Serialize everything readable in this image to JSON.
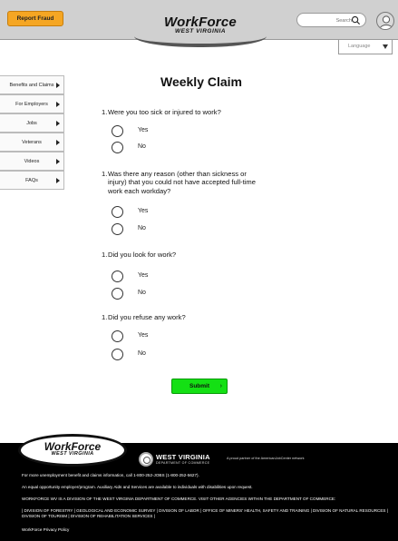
{
  "header": {
    "report_fraud_label": "Report Fraud",
    "logo_main": "WorkForce",
    "logo_sub": "WEST VIRGINIA",
    "search_placeholder": "Search",
    "language_label": "Language"
  },
  "sidebar": {
    "items": [
      {
        "label": "Benefits and Claims"
      },
      {
        "label": "For Employers"
      },
      {
        "label": "Jobs"
      },
      {
        "label": "Veterans"
      },
      {
        "label": "Videos"
      },
      {
        "label": "FAQs"
      }
    ]
  },
  "form": {
    "title": "Weekly Claim",
    "questions": [
      {
        "number": "1.",
        "text": "Were you too sick or injured to work?",
        "options": [
          "Yes",
          "No"
        ]
      },
      {
        "number": "1.",
        "text": "Was there any reason (other than sickness or injury) that you could not have accepted full-time work each workday?",
        "options": [
          "Yes",
          "No"
        ]
      },
      {
        "number": "1.",
        "text": "Did you look for work?",
        "options": [
          "Yes",
          "No"
        ]
      },
      {
        "number": "1.",
        "text": "Did you refuse any work?",
        "options": [
          "Yes",
          "No"
        ]
      }
    ],
    "submit_label": "Submit",
    "submit_chevron": "›"
  },
  "footer": {
    "logo_main": "WorkForce",
    "logo_sub": "WEST VIRGINIA",
    "brand_name": "WEST VIRGINIA",
    "brand_dept": "DEPARTMENT OF COMMERCE",
    "partner_text": "A proud partner of the AmericanJobCenter network",
    "line1": "For more unemployment benefit and claims information, call 1-800-252-JOBS (1-800-252-5627).",
    "line2": "An equal opportunity employer/program. Auxiliary Aids and Services are available to individuals with disabilities upon request.",
    "line3": "WORKFORCE WV IS A DIVISION OF THE WEST VIRGINIA DEPARTMENT OF COMMERCE. VISIT OTHER AGENCIES WITHIN THE DEPARTMENT OF COMMERCE:",
    "line4": "| DIVISION OF FORESTRY | GEOLOGICAL AND ECONOMIC SURVEY | DIVISION OF LABOR | OFFICE OF MINERS' HEALTH, SAFETY AND TRAINING | DIVISION OF NATURAL RESOURCES | DIVISION OF TOURISM | DIVISION OF REHABILITATION SERVICES |",
    "privacy_link": "WorkForce Privacy Policy"
  },
  "colors": {
    "report_fraud": "#f5a623",
    "submit": "#14e014",
    "header_bg": "#d0d0d0",
    "footer_bg": "#000000"
  },
  "icons": [
    "search-icon",
    "user-avatar-icon",
    "chevron-down-icon",
    "caret-right-icon",
    "wv-seal-icon"
  ]
}
